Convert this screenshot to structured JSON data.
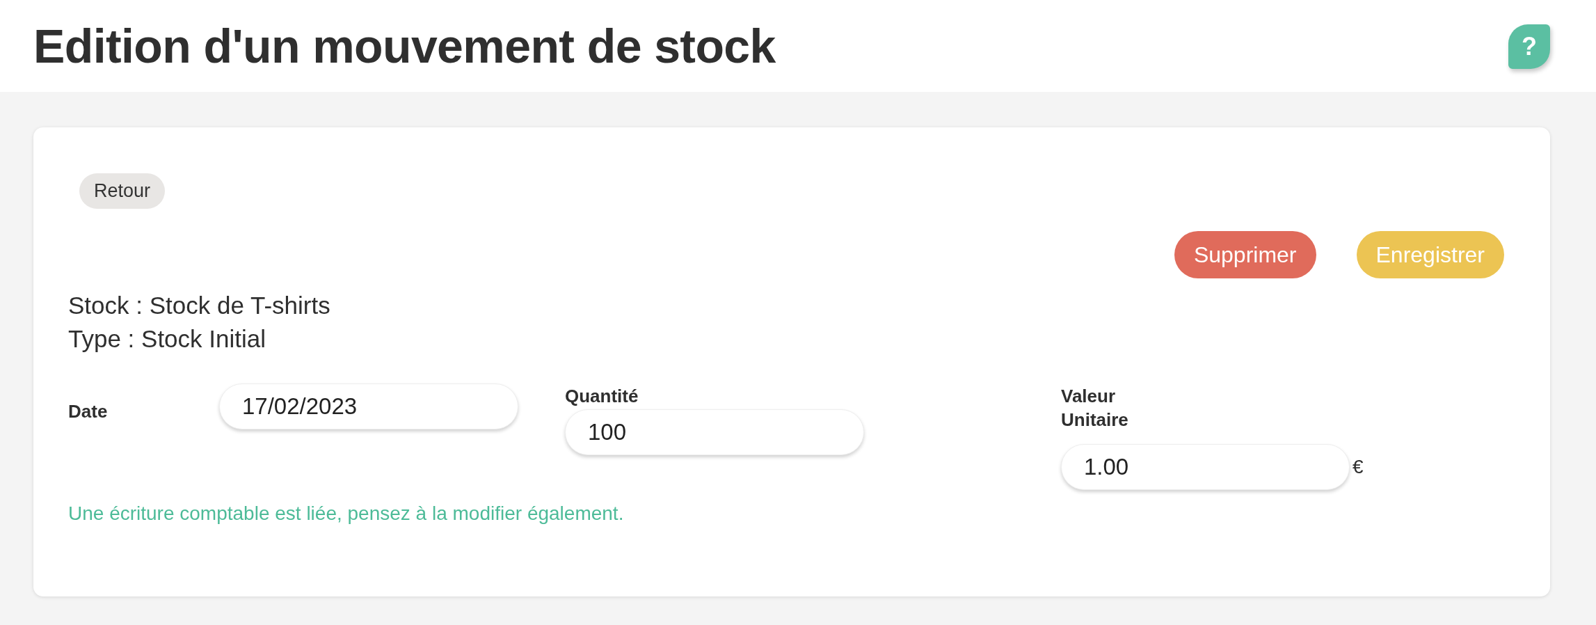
{
  "header": {
    "title": "Edition d'un mouvement de stock",
    "help_button": {
      "label": "?"
    }
  },
  "card": {
    "back_button": {
      "label": "Retour"
    },
    "actions": [
      {
        "label": "Supprimer",
        "kind": "danger"
      },
      {
        "label": "Enregistrer",
        "kind": "save"
      }
    ],
    "info_lines": [
      "Stock : Stock de T-shirts",
      "Type : Stock Initial"
    ],
    "fields": [
      {
        "label": "Date",
        "value": "17/02/2023",
        "kind": "inline"
      },
      {
        "label": "Quantité",
        "value": "100",
        "kind": "stacked"
      },
      {
        "label": "Valeur Unitaire",
        "value": "1.00",
        "kind": "stacked",
        "unit": "€"
      }
    ],
    "note": "Une écriture comptable est liée, pensez à la modifier également."
  }
}
